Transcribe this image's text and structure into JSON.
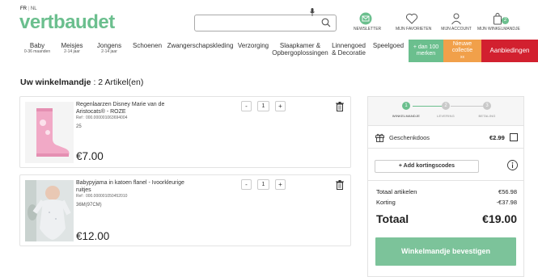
{
  "header": {
    "lang_fr": "FR",
    "lang_sep": "|",
    "lang_nl": "NL",
    "logo": "vertbaudet",
    "search_placeholder": "",
    "newsletter": "NEWSLETTER",
    "favorites": "MIJN FAVORIETEN",
    "account": "MIJN ACCOUNT",
    "cart": "MIJN WINKELMANDJE",
    "cart_count": "2",
    "accent_color": "#6bbf8e"
  },
  "nav": {
    "items": [
      {
        "label": "Baby",
        "sub": "0-36 maanden"
      },
      {
        "label": "Meisjes",
        "sub": "2-14 jaar"
      },
      {
        "label": "Jongens",
        "sub": "2-14 jaar"
      },
      {
        "label": "Schoenen",
        "sub": ""
      },
      {
        "label": "Zwangerschapskleding",
        "sub": ""
      },
      {
        "label": "Verzorging",
        "sub": ""
      },
      {
        "label": "Slaapkamer & Opbergoplossingen",
        "sub": ""
      },
      {
        "label": "Linnengoed & Decoratie",
        "sub": ""
      },
      {
        "label": "Speelgoed",
        "sub": ""
      }
    ],
    "promo_brands": "+ dan 100 merken",
    "promo_new": "Nieuwe collectie",
    "promo_new_sub": "xx",
    "promo_deals": "Aanbiedingen"
  },
  "cart": {
    "title_prefix": "Uw winkelmandje",
    "title_count": ": 2 Artikel(en)",
    "items": [
      {
        "name": "Regenlaarzen Disney Marie van de Aristocats® - ROZE",
        "ref": "Ref : 000.000001063694004",
        "size": "25",
        "qty": "1",
        "price": "€7.00",
        "minus": "-",
        "plus": "+"
      },
      {
        "name": "Babypyjama in katoen flanel - Ivoorkleurige ruitjes",
        "ref": "Ref : 000.000001050452010",
        "size": "36M(97CM)",
        "qty": "1",
        "price": "€12.00",
        "minus": "-",
        "plus": "+"
      }
    ]
  },
  "summary": {
    "steps": [
      {
        "num": "1",
        "label": "WINKELMANDJE"
      },
      {
        "num": "2",
        "label": "LEVERING"
      },
      {
        "num": "3",
        "label": "BETALING"
      }
    ],
    "gift_label": "Geschenkdoos",
    "gift_price": "€2.99",
    "promo_button": "+ Add kortingscodes",
    "total_articles_label": "Totaal artikelen",
    "total_articles_value": "€56.98",
    "discount_label": "Korting",
    "discount_value": "-€37.98",
    "total_label": "Totaal",
    "total_value": "€19.00",
    "confirm_button": "Winkelmandje bevestigen"
  }
}
